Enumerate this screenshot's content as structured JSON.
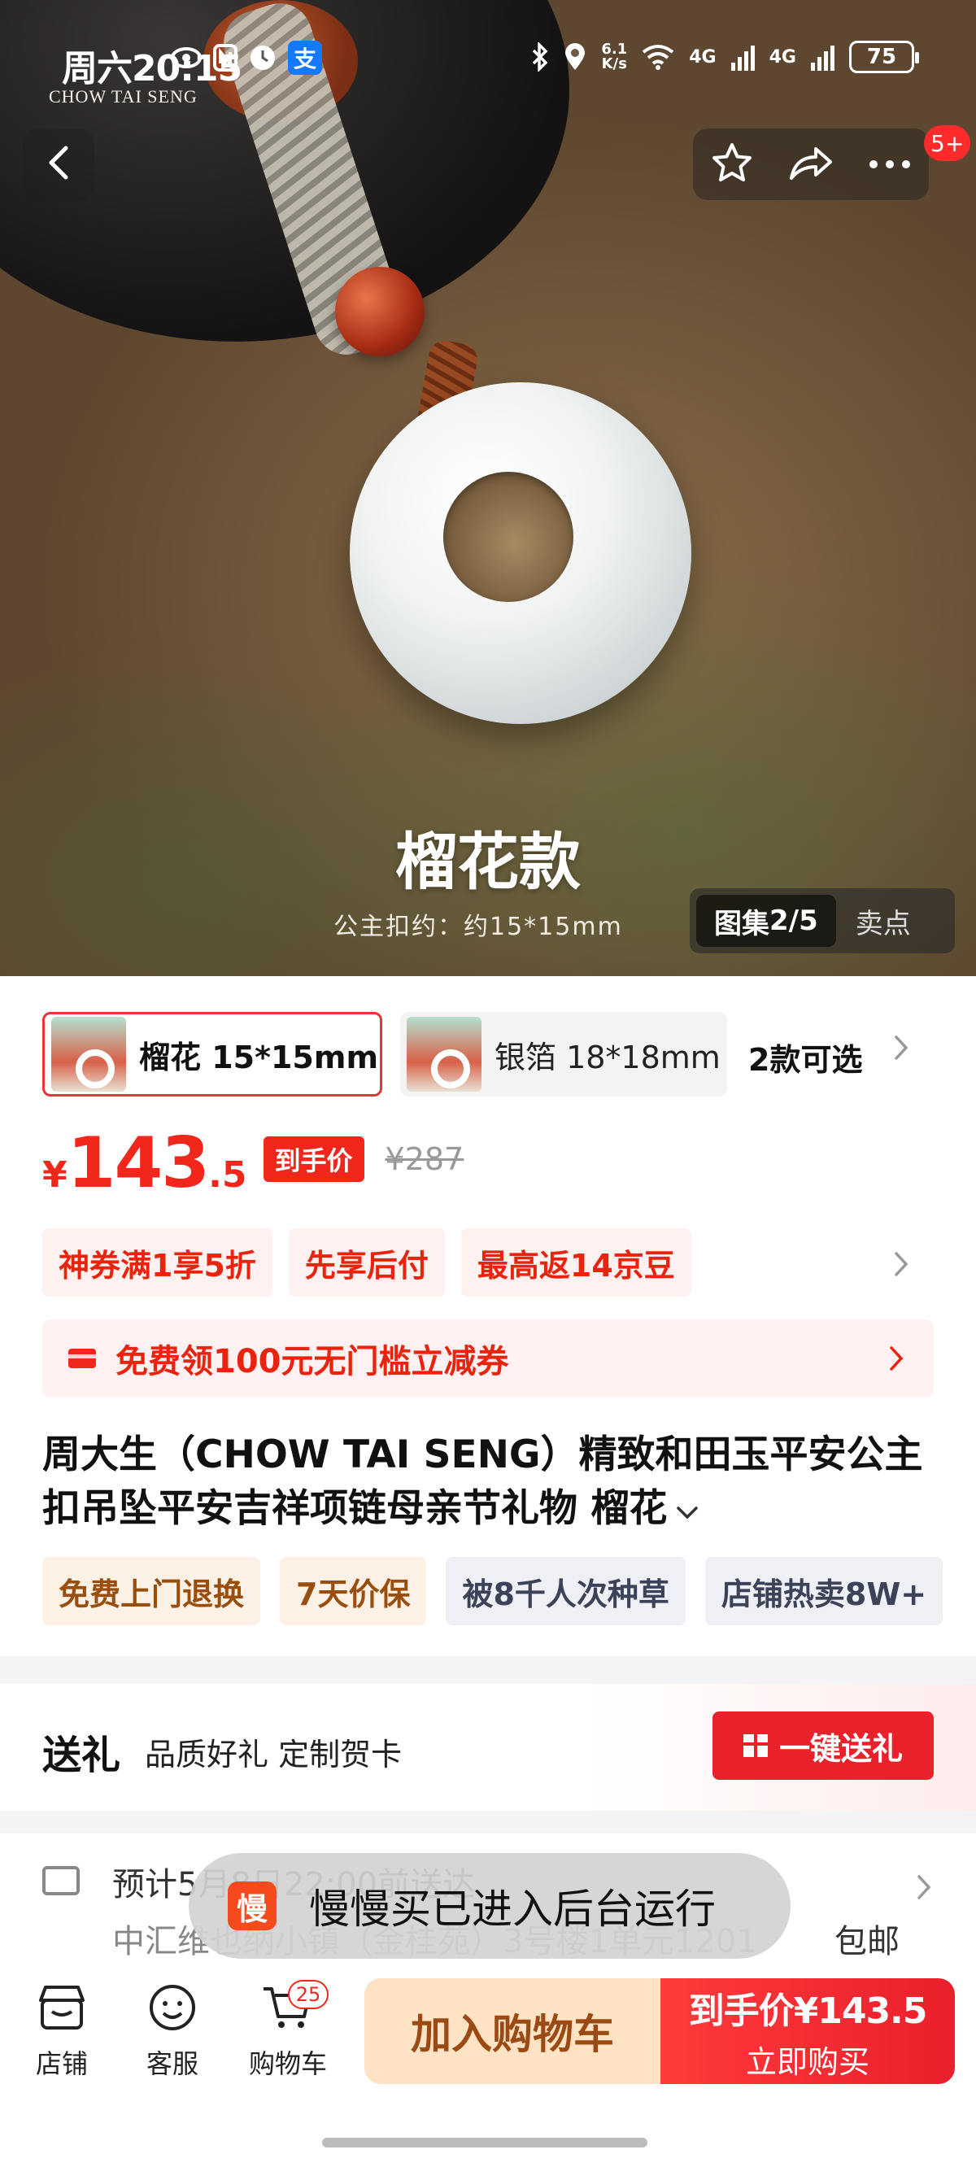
{
  "status": {
    "time": "周六20:15",
    "speed_value": "6.1",
    "speed_unit": "K/s",
    "net1": "4G",
    "net2": "4G",
    "battery": "75"
  },
  "hero": {
    "brand": "CHOW TAI SENG",
    "badge": "5+",
    "title": "榴花款",
    "subtitle": "公主扣约：约15*15mm",
    "gallery_label": "图集",
    "gallery_index": "2/5",
    "selling_points": "卖点"
  },
  "variants": {
    "items": [
      {
        "label": "榴花 15*15mm",
        "selected": true
      },
      {
        "label": "银箔 18*18mm",
        "selected": false
      }
    ],
    "more": "2款可选"
  },
  "price": {
    "currency": "¥",
    "integer": "143",
    "decimal": ".5",
    "tag": "到手价",
    "original": "¥287"
  },
  "promos": [
    "神券满1享5折",
    "先享后付",
    "最高返14京豆"
  ],
  "coupon": {
    "text": "免费领100元无门槛立减券"
  },
  "title": "周大生（CHOW TAI SENG）精致和田玉平安公主扣吊坠平安吉祥项链母亲节礼物 榴花",
  "tags": [
    {
      "text": "免费上门退换",
      "style": "orange"
    },
    {
      "text": "7天价保",
      "style": "orange"
    },
    {
      "text": "被8千人次种草",
      "style": "gray"
    },
    {
      "text": "店铺热卖8W+",
      "style": "gray"
    }
  ],
  "gift": {
    "title": "送礼",
    "subtitle": "品质好礼 定制贺卡",
    "button": "一键送礼"
  },
  "delivery": {
    "line1": "预计5月8日22:00前送达",
    "line2": "中汇维也纳小镇（金桂苑）3号楼1单元1201",
    "free_shipping": "包邮"
  },
  "toast": {
    "icon": "慢",
    "text": "慢慢买已进入后台运行"
  },
  "bottom": {
    "shop": "店铺",
    "service": "客服",
    "cart": "购物车",
    "cart_count": "25",
    "add_to_cart": "加入购物车",
    "buy_price": "到手价¥143.5",
    "buy_label": "立即购买"
  },
  "colors": {
    "accent": "#f2271c",
    "cart_bg": "#ffe3c4"
  }
}
